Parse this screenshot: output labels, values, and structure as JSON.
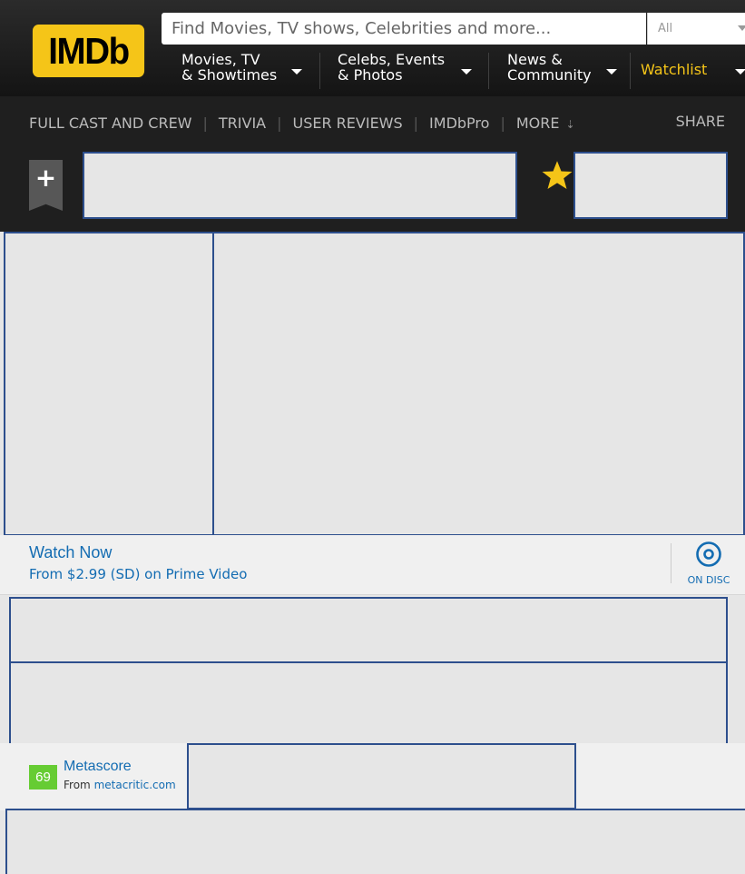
{
  "header": {
    "logo_text": "IMDb",
    "search": {
      "value": "",
      "placeholder": "Find Movies, TV shows, Celebrities and more...",
      "category": "All"
    },
    "nav": [
      {
        "line1": "Movies, TV",
        "line2": "& Showtimes"
      },
      {
        "line1": "Celebs, Events",
        "line2": "& Photos"
      },
      {
        "line1": "News &",
        "line2": "Community"
      }
    ],
    "watchlist_label": "Watchlist"
  },
  "subnav": {
    "links": [
      "FULL CAST AND CREW",
      "TRIVIA",
      "USER REVIEWS",
      "IMDbPro",
      "MORE"
    ],
    "share_label": "SHARE"
  },
  "watch": {
    "title": "Watch Now",
    "subtitle": "From $2.99 (SD) on Prime Video",
    "disc_label": "ON DISC"
  },
  "metascore": {
    "score": "69",
    "label": "Metascore",
    "from_prefix": "From",
    "source": "metacritic.com"
  },
  "colors": {
    "brand_yellow": "#f5c518",
    "link_blue": "#136cb2",
    "metascore_green": "#66cc33",
    "placeholder_border": "#2d4f8d"
  },
  "icons": [
    "plus-icon",
    "star-icon",
    "disc-icon",
    "chevron-down-icon"
  ]
}
